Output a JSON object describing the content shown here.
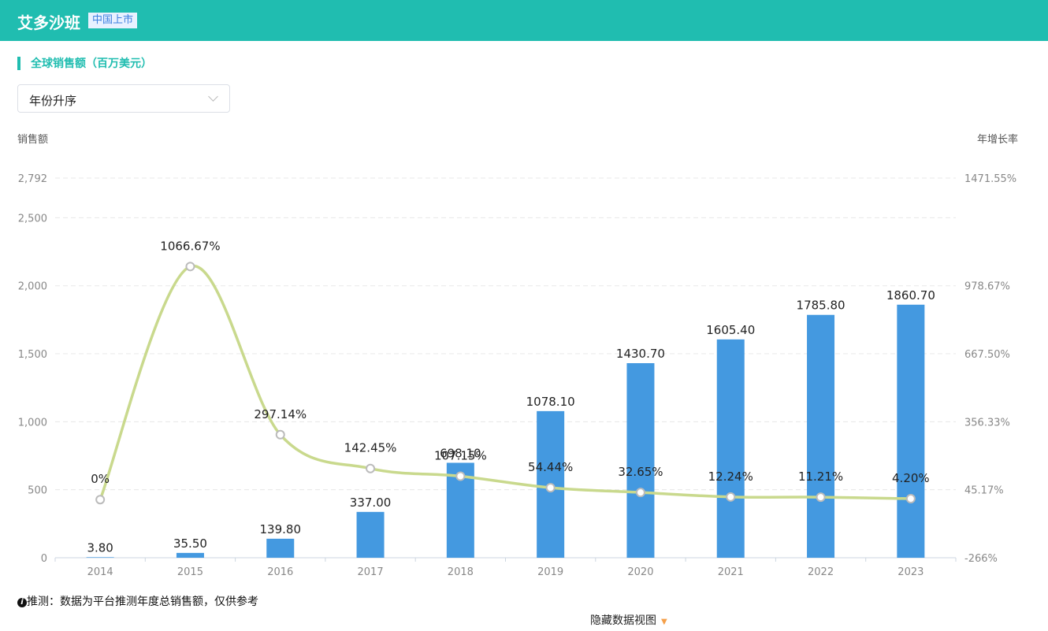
{
  "header": {
    "company": "艾多沙班",
    "badge": "中国上市"
  },
  "section_title": "全球销售额（百万美元）",
  "sort_select": {
    "value": "年份升序"
  },
  "note": {
    "icon": "info-icon",
    "text": "推测：数据为平台推测年度总销售额，仅供参考"
  },
  "toggle_label": "隐藏数据视图",
  "colors": {
    "bar": "#4499e0",
    "line": "#c9d98d",
    "accent": "#20bdb0"
  },
  "chart_data": {
    "type": "bar+line",
    "categories": [
      "2014",
      "2015",
      "2016",
      "2017",
      "2018",
      "2019",
      "2020",
      "2021",
      "2022",
      "2023"
    ],
    "series": [
      {
        "name": "销售额",
        "type": "bar",
        "axis": "left",
        "values": [
          3.8,
          35.5,
          139.8,
          337.0,
          698.1,
          1078.1,
          1430.7,
          1605.4,
          1785.8,
          1860.7
        ],
        "labels": [
          "3.80",
          "35.50",
          "139.80",
          "337.00",
          "698.10",
          "1078.10",
          "1430.70",
          "1605.40",
          "1785.80",
          "1860.70"
        ]
      },
      {
        "name": "年增长率",
        "type": "line",
        "axis": "right",
        "values": [
          0,
          1066.67,
          297.14,
          142.45,
          107.15,
          54.44,
          32.65,
          12.24,
          11.21,
          4.2
        ],
        "labels": [
          "0%",
          "1066.67%",
          "297.14%",
          "142.45%",
          "107.15%",
          "54.44%",
          "32.65%",
          "12.24%",
          "11.21%",
          "4.20%"
        ]
      }
    ],
    "left_axis": {
      "title": "销售额",
      "range": [
        0,
        2792
      ],
      "ticks": [
        0,
        500,
        1000,
        1500,
        2000,
        2500,
        2792
      ],
      "tick_labels": [
        "0",
        "500",
        "1,000",
        "1,500",
        "2,000",
        "2,500",
        "2,792"
      ]
    },
    "right_axis": {
      "title": "年增长率",
      "range": [
        -266,
        1471.55
      ],
      "ticks": [
        -266,
        45.17,
        356.33,
        667.5,
        978.67,
        1471.55
      ],
      "tick_labels": [
        "-266%",
        "45.17%",
        "356.33%",
        "667.50%",
        "978.67%",
        "1471.55%"
      ]
    },
    "grid": true
  }
}
